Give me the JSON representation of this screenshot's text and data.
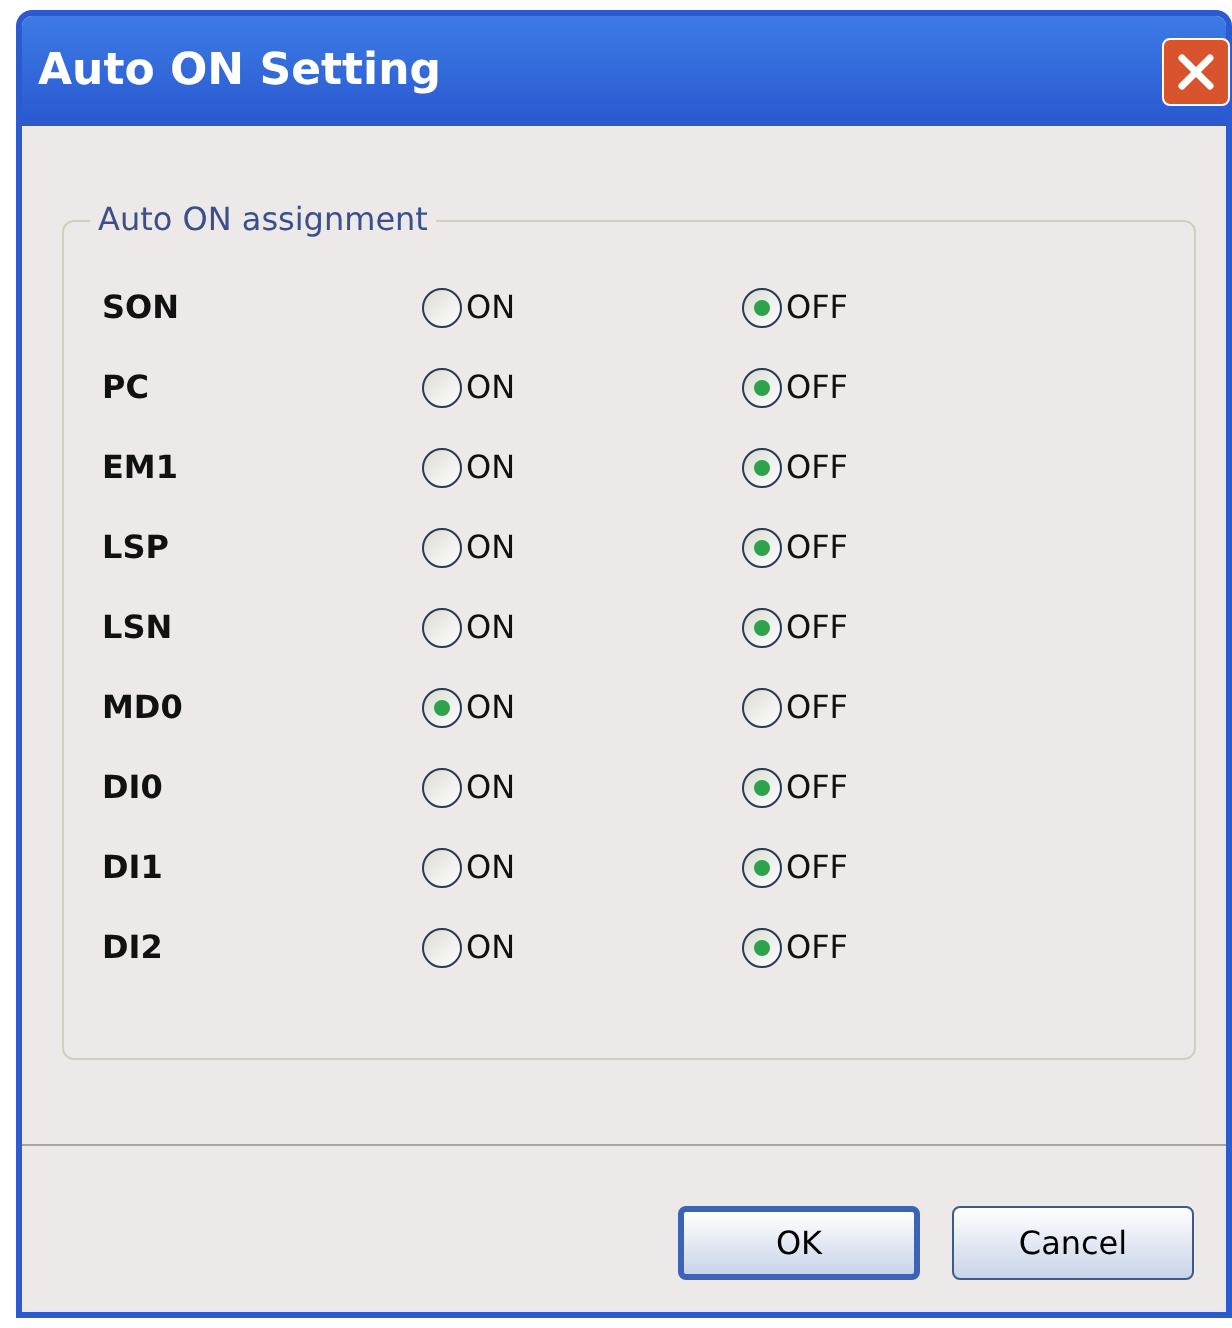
{
  "window": {
    "title": "Auto ON Setting"
  },
  "group": {
    "title": "Auto ON assignment"
  },
  "rows": [
    {
      "name": "SON",
      "options": [
        {
          "label": "ON",
          "selected": false
        },
        {
          "label": "OFF",
          "selected": true
        }
      ]
    },
    {
      "name": "PC",
      "options": [
        {
          "label": "ON",
          "selected": false
        },
        {
          "label": "OFF",
          "selected": true
        }
      ]
    },
    {
      "name": "EM1",
      "options": [
        {
          "label": "ON",
          "selected": false
        },
        {
          "label": "OFF",
          "selected": true
        }
      ]
    },
    {
      "name": "LSP",
      "options": [
        {
          "label": "ON",
          "selected": false
        },
        {
          "label": "OFF",
          "selected": true
        }
      ]
    },
    {
      "name": "LSN",
      "options": [
        {
          "label": "ON",
          "selected": false
        },
        {
          "label": "OFF",
          "selected": true
        }
      ]
    },
    {
      "name": "MD0",
      "options": [
        {
          "label": "ON",
          "selected": true
        },
        {
          "label": "OFF",
          "selected": false
        }
      ]
    },
    {
      "name": "DI0",
      "options": [
        {
          "label": "ON",
          "selected": false
        },
        {
          "label": "OFF",
          "selected": true
        }
      ]
    },
    {
      "name": "DI1",
      "options": [
        {
          "label": "ON",
          "selected": false
        },
        {
          "label": "OFF",
          "selected": true
        }
      ]
    },
    {
      "name": "DI2",
      "options": [
        {
          "label": "ON",
          "selected": false
        },
        {
          "label": "OFF",
          "selected": true
        }
      ]
    }
  ],
  "buttons": [
    {
      "label": "OK",
      "default": true
    },
    {
      "label": "Cancel",
      "default": false
    }
  ]
}
